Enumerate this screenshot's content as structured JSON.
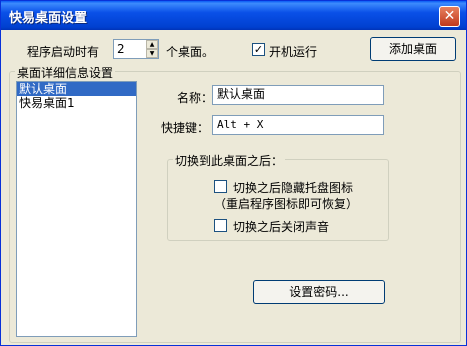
{
  "window": {
    "title": "快易桌面设置"
  },
  "startup": {
    "prefix_label": "程序启动时有",
    "count_value": "2",
    "suffix_label": "个桌面。",
    "boot_run_label": "开机运行",
    "boot_run_checked": true,
    "add_desktop_button": "添加桌面"
  },
  "details": {
    "group_title": "桌面详细信息设置",
    "desktops": [
      {
        "label": "默认桌面",
        "selected": true
      },
      {
        "label": "快易桌面1",
        "selected": false
      }
    ],
    "name_label": "名称：",
    "name_value": "默认桌面",
    "hotkey_label": "快捷键：",
    "hotkey_value": "Alt + X",
    "after_switch": {
      "group_title": "切换到此桌面之后：",
      "hide_tray_label": "切换之后隐藏托盘图标",
      "hide_tray_checked": false,
      "hide_tray_note": "（重启程序图标即可恢复）",
      "mute_label": "切换之后关闭声音",
      "mute_checked": false
    },
    "set_password_button": "设置密码..."
  },
  "icons": {
    "close": "close-icon",
    "spin_up": "arrow-up-icon",
    "spin_down": "arrow-down-icon",
    "check": "checkmark-icon"
  }
}
